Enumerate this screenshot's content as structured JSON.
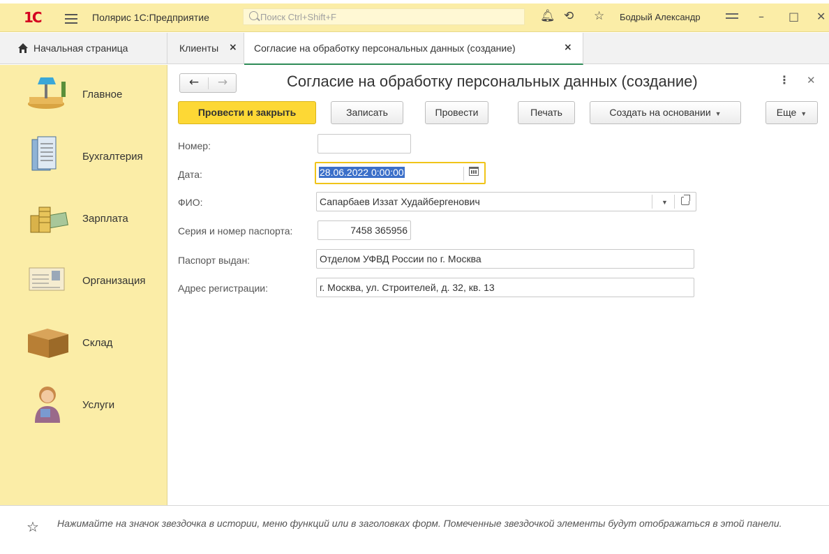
{
  "titlebar": {
    "logo": "1С",
    "app_title": "Полярис 1С:Предприятие",
    "search_placeholder": "Поиск Ctrl+Shift+F",
    "user_name": "Бодрый Александр"
  },
  "tabs": [
    {
      "label": "Начальная страница"
    },
    {
      "label": "Клиенты"
    },
    {
      "label": "Согласие на обработку персональных данных (создание)"
    }
  ],
  "sidebar": {
    "items": [
      {
        "label": "Главное",
        "icon": "desk-lamp-icon"
      },
      {
        "label": "Бухгалтерия",
        "icon": "documents-icon"
      },
      {
        "label": "Зарплата",
        "icon": "coins-money-icon"
      },
      {
        "label": "Организация",
        "icon": "id-card-icon"
      },
      {
        "label": "Склад",
        "icon": "box-icon"
      },
      {
        "label": "Услуги",
        "icon": "service-person-icon"
      }
    ]
  },
  "form": {
    "title": "Согласие на обработку персональных данных (создание)",
    "buttons": {
      "post_close": "Провести и закрыть",
      "save": "Записать",
      "post": "Провести",
      "print": "Печать",
      "create_based": "Создать на основании",
      "more": "Еще"
    },
    "fields": {
      "number_label": "Номер:",
      "number_value": "",
      "date_label": "Дата:",
      "date_value": "28.06.2022  0:00:00",
      "fio_label": "ФИО:",
      "fio_value": "Сапарбаев Иззат Худайбергенович",
      "passport_label": "Серия и номер паспорта:",
      "passport_value": "7458 365956",
      "issued_label": "Паспорт выдан:",
      "issued_value": "Отделом УФВД России по г. Москва",
      "address_label": "Адрес регистрации:",
      "address_value": "г. Москва, ул. Строителей, д. 32, кв. 13"
    }
  },
  "bottom_panel": {
    "hint": "Нажимайте на значок звездочка в истории, меню функций или в заголовках форм. Помеченные звездочкой элементы будут отображаться в этой панели."
  },
  "colors": {
    "accent_yellow": "#fdd835",
    "panel_yellow": "#fbeda7",
    "active_tab_underline": "#2e8b57",
    "logo_red": "#d4001f"
  }
}
